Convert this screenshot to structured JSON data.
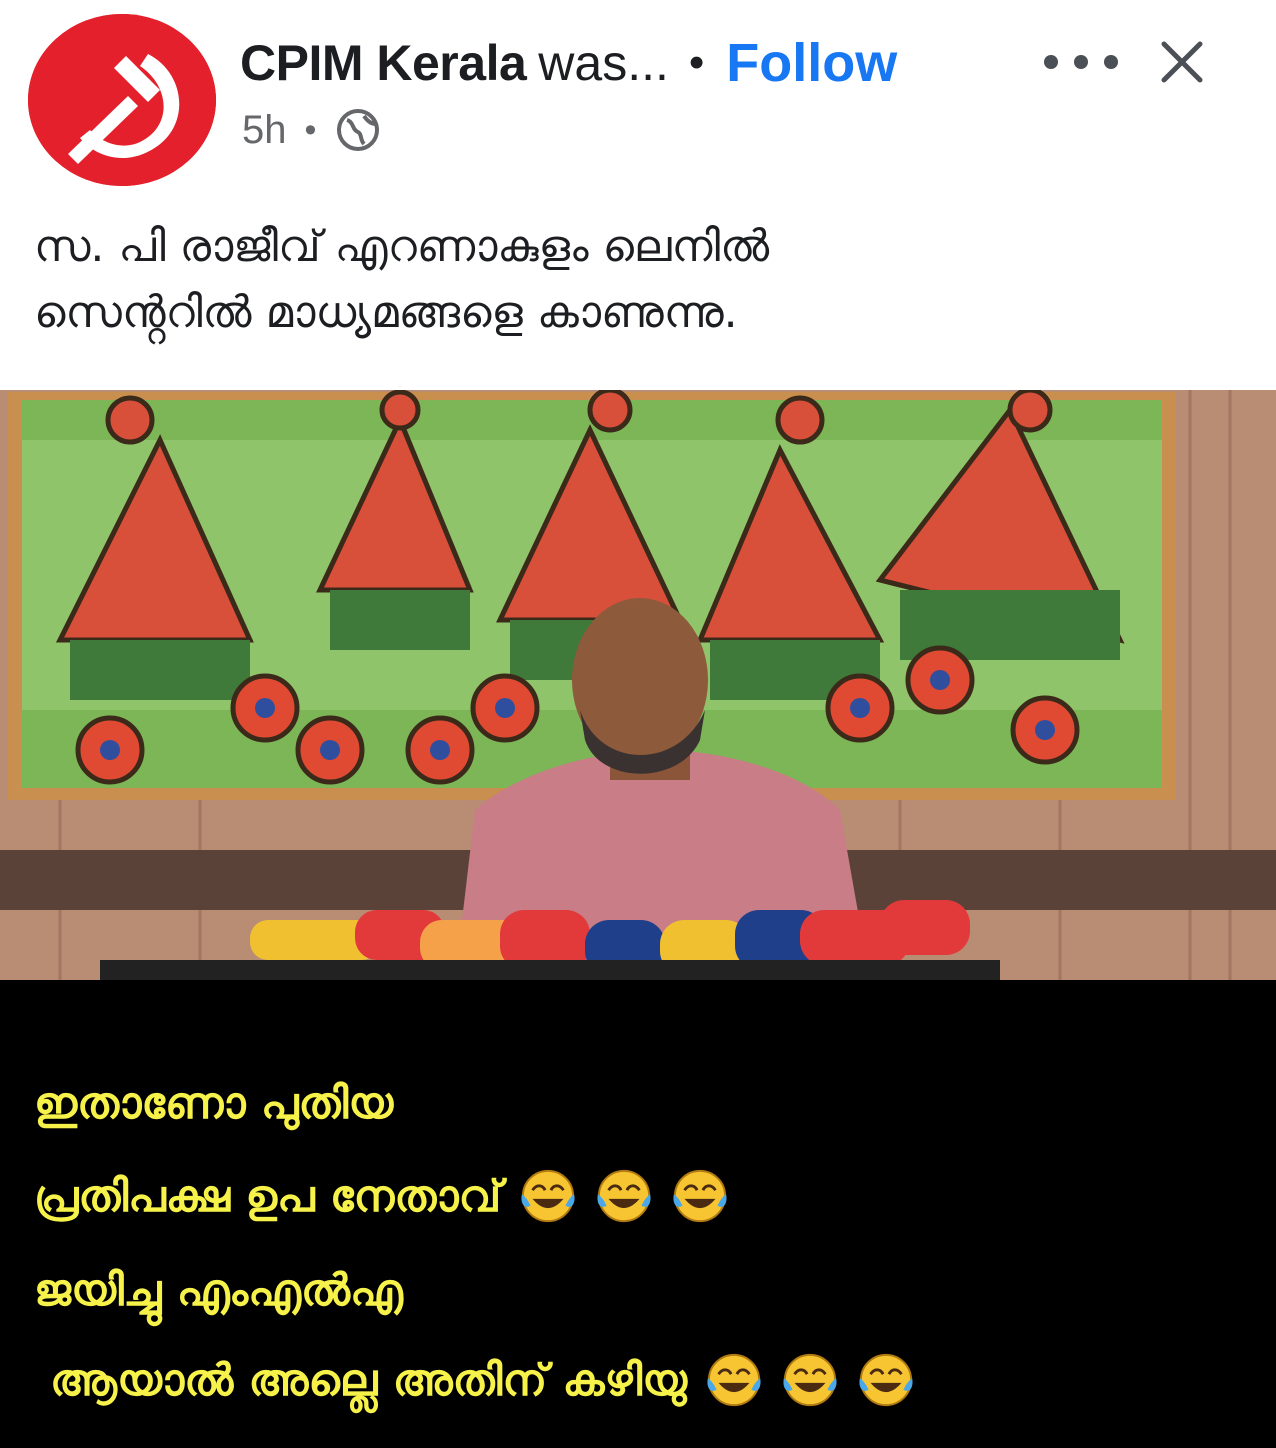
{
  "post": {
    "page_name": "CPIM Kerala",
    "was_text": "was...",
    "separator": "•",
    "follow_label": "Follow",
    "timestamp": "5h",
    "meta_separator": "•",
    "audience_icon": "globe-icon",
    "more_icon": "more-options-icon",
    "close_icon": "close-icon",
    "caption_lines": [
      "സ. പി രാജീവ് എറണാകുളം ലെനിൽ",
      "സെൻ്ററിൽ മാധ്യമങ്ങളെ കാണുന്നു."
    ]
  },
  "photo": {
    "description_icon": "press-conference-photo",
    "overlay_lines": [
      "ഇതാണോ പുതിയ",
      "പ്രതിപക്ഷ ഉപ നേതാവ്",
      "ജയിച്ചു എംഎൽഎ",
      "ആയാൽ അല്ലെ അതിന് കഴിയു"
    ],
    "emoji": "face-with-tears-of-joy-icon"
  },
  "colors": {
    "brand_red": "#e3202b",
    "follow_blue": "#1877f2",
    "overlay_text": "#f6f24a",
    "panel_bg": "#000000"
  }
}
